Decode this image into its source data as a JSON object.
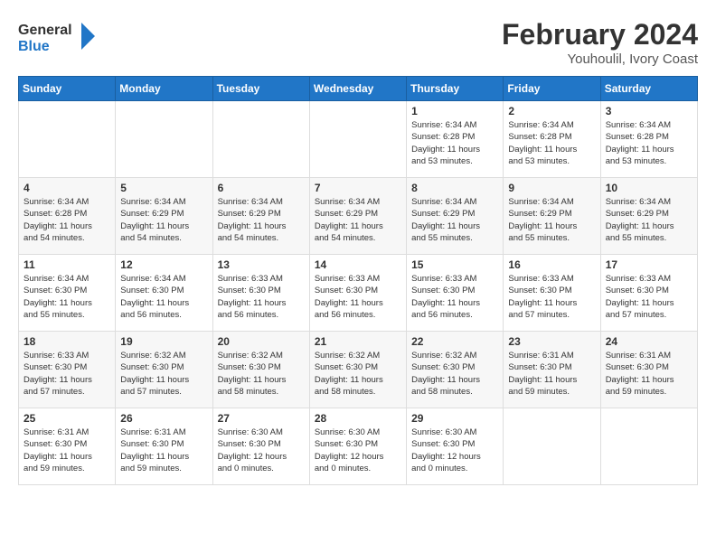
{
  "logo": {
    "text_general": "General",
    "text_blue": "Blue"
  },
  "title": "February 2024",
  "subtitle": "Youhoulil, Ivory Coast",
  "days_of_week": [
    "Sunday",
    "Monday",
    "Tuesday",
    "Wednesday",
    "Thursday",
    "Friday",
    "Saturday"
  ],
  "weeks": [
    [
      {
        "day": "",
        "info": ""
      },
      {
        "day": "",
        "info": ""
      },
      {
        "day": "",
        "info": ""
      },
      {
        "day": "",
        "info": ""
      },
      {
        "day": "1",
        "info": "Sunrise: 6:34 AM\nSunset: 6:28 PM\nDaylight: 11 hours\nand 53 minutes."
      },
      {
        "day": "2",
        "info": "Sunrise: 6:34 AM\nSunset: 6:28 PM\nDaylight: 11 hours\nand 53 minutes."
      },
      {
        "day": "3",
        "info": "Sunrise: 6:34 AM\nSunset: 6:28 PM\nDaylight: 11 hours\nand 53 minutes."
      }
    ],
    [
      {
        "day": "4",
        "info": "Sunrise: 6:34 AM\nSunset: 6:28 PM\nDaylight: 11 hours\nand 54 minutes."
      },
      {
        "day": "5",
        "info": "Sunrise: 6:34 AM\nSunset: 6:29 PM\nDaylight: 11 hours\nand 54 minutes."
      },
      {
        "day": "6",
        "info": "Sunrise: 6:34 AM\nSunset: 6:29 PM\nDaylight: 11 hours\nand 54 minutes."
      },
      {
        "day": "7",
        "info": "Sunrise: 6:34 AM\nSunset: 6:29 PM\nDaylight: 11 hours\nand 54 minutes."
      },
      {
        "day": "8",
        "info": "Sunrise: 6:34 AM\nSunset: 6:29 PM\nDaylight: 11 hours\nand 55 minutes."
      },
      {
        "day": "9",
        "info": "Sunrise: 6:34 AM\nSunset: 6:29 PM\nDaylight: 11 hours\nand 55 minutes."
      },
      {
        "day": "10",
        "info": "Sunrise: 6:34 AM\nSunset: 6:29 PM\nDaylight: 11 hours\nand 55 minutes."
      }
    ],
    [
      {
        "day": "11",
        "info": "Sunrise: 6:34 AM\nSunset: 6:30 PM\nDaylight: 11 hours\nand 55 minutes."
      },
      {
        "day": "12",
        "info": "Sunrise: 6:34 AM\nSunset: 6:30 PM\nDaylight: 11 hours\nand 56 minutes."
      },
      {
        "day": "13",
        "info": "Sunrise: 6:33 AM\nSunset: 6:30 PM\nDaylight: 11 hours\nand 56 minutes."
      },
      {
        "day": "14",
        "info": "Sunrise: 6:33 AM\nSunset: 6:30 PM\nDaylight: 11 hours\nand 56 minutes."
      },
      {
        "day": "15",
        "info": "Sunrise: 6:33 AM\nSunset: 6:30 PM\nDaylight: 11 hours\nand 56 minutes."
      },
      {
        "day": "16",
        "info": "Sunrise: 6:33 AM\nSunset: 6:30 PM\nDaylight: 11 hours\nand 57 minutes."
      },
      {
        "day": "17",
        "info": "Sunrise: 6:33 AM\nSunset: 6:30 PM\nDaylight: 11 hours\nand 57 minutes."
      }
    ],
    [
      {
        "day": "18",
        "info": "Sunrise: 6:33 AM\nSunset: 6:30 PM\nDaylight: 11 hours\nand 57 minutes."
      },
      {
        "day": "19",
        "info": "Sunrise: 6:32 AM\nSunset: 6:30 PM\nDaylight: 11 hours\nand 57 minutes."
      },
      {
        "day": "20",
        "info": "Sunrise: 6:32 AM\nSunset: 6:30 PM\nDaylight: 11 hours\nand 58 minutes."
      },
      {
        "day": "21",
        "info": "Sunrise: 6:32 AM\nSunset: 6:30 PM\nDaylight: 11 hours\nand 58 minutes."
      },
      {
        "day": "22",
        "info": "Sunrise: 6:32 AM\nSunset: 6:30 PM\nDaylight: 11 hours\nand 58 minutes."
      },
      {
        "day": "23",
        "info": "Sunrise: 6:31 AM\nSunset: 6:30 PM\nDaylight: 11 hours\nand 59 minutes."
      },
      {
        "day": "24",
        "info": "Sunrise: 6:31 AM\nSunset: 6:30 PM\nDaylight: 11 hours\nand 59 minutes."
      }
    ],
    [
      {
        "day": "25",
        "info": "Sunrise: 6:31 AM\nSunset: 6:30 PM\nDaylight: 11 hours\nand 59 minutes."
      },
      {
        "day": "26",
        "info": "Sunrise: 6:31 AM\nSunset: 6:30 PM\nDaylight: 11 hours\nand 59 minutes."
      },
      {
        "day": "27",
        "info": "Sunrise: 6:30 AM\nSunset: 6:30 PM\nDaylight: 12 hours\nand 0 minutes."
      },
      {
        "day": "28",
        "info": "Sunrise: 6:30 AM\nSunset: 6:30 PM\nDaylight: 12 hours\nand 0 minutes."
      },
      {
        "day": "29",
        "info": "Sunrise: 6:30 AM\nSunset: 6:30 PM\nDaylight: 12 hours\nand 0 minutes."
      },
      {
        "day": "",
        "info": ""
      },
      {
        "day": "",
        "info": ""
      }
    ]
  ]
}
